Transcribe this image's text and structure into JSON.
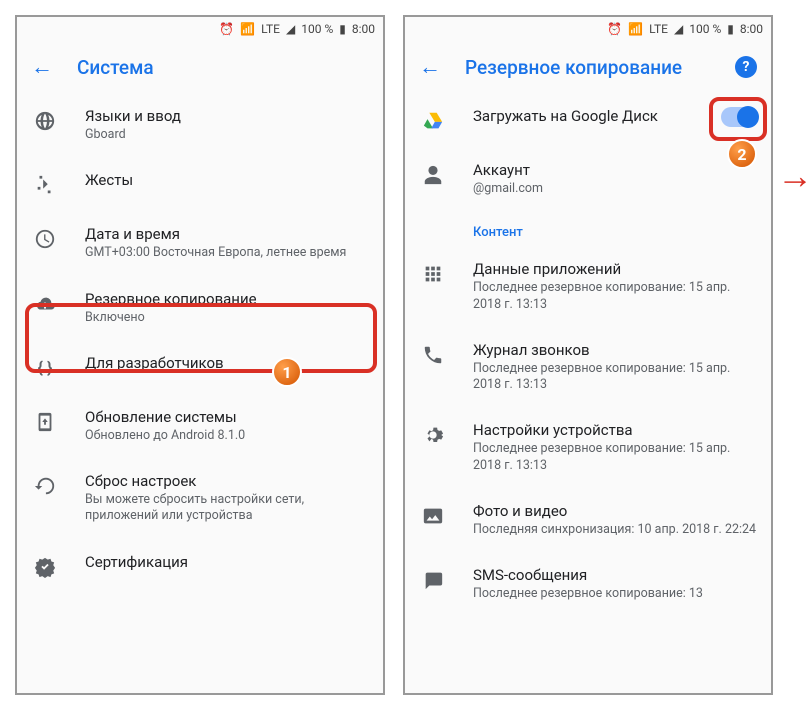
{
  "statusbar": {
    "battery": "100 %",
    "time": "8:00",
    "network": "LTE"
  },
  "left": {
    "title": "Система",
    "items": [
      {
        "title": "Языки и ввод",
        "sub": "Gboard"
      },
      {
        "title": "Жесты",
        "sub": ""
      },
      {
        "title": "Дата и время",
        "sub": "GMT+03:00 Восточная Европа, летнее время"
      },
      {
        "title": "Резервное копирование",
        "sub": "Включено"
      },
      {
        "title": "Для разработчиков",
        "sub": ""
      },
      {
        "title": "Обновление системы",
        "sub": "Обновлено до Android 8.1.0"
      },
      {
        "title": "Сброс настроек",
        "sub": "Вы можете сбросить настройки сети, приложений или устройства"
      },
      {
        "title": "Сертификация",
        "sub": ""
      }
    ]
  },
  "right": {
    "title": "Резервное копирование",
    "upload": {
      "title": "Загружать на Google Диск"
    },
    "account": {
      "title": "Аккаунт",
      "sub": "@gmail.com"
    },
    "section": "Контент",
    "items": [
      {
        "title": "Данные приложений",
        "sub": "Последнее резервное копирование: 15 апр. 2018 г. 13:13"
      },
      {
        "title": "Журнал звонков",
        "sub": "Последнее резервное копирование: 15 апр. 2018 г. 13:13"
      },
      {
        "title": "Настройки устройства",
        "sub": "Последнее резервное копирование: 15 апр. 2018 г. 13:13"
      },
      {
        "title": "Фото и видео",
        "sub": "Последняя синхронизация: 10 апр. 2018 г. 22:24"
      },
      {
        "title": "SMS-сообщения",
        "sub": "Последнее резервное копирование: 13"
      }
    ]
  },
  "badges": {
    "one": "1",
    "two": "2"
  }
}
